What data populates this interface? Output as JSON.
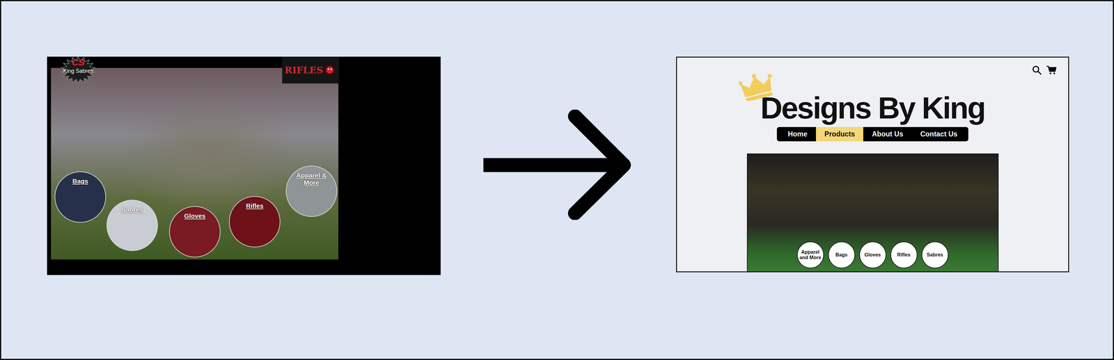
{
  "before": {
    "logo": {
      "mark": "CS",
      "name": "King Sabres"
    },
    "badge": "RIFLES",
    "categories": [
      {
        "label": "Bags",
        "color": "#26304a"
      },
      {
        "label": "Sabres",
        "color": "#c9ccd3"
      },
      {
        "label": "Gloves",
        "color": "#7a1a22"
      },
      {
        "label": "Rifles",
        "color": "#6e1119"
      },
      {
        "label": "Apparel & More",
        "color": "#8f9497"
      }
    ]
  },
  "after": {
    "title": "Designs By King",
    "nav": [
      {
        "label": "Home",
        "selected": false
      },
      {
        "label": "Products",
        "selected": true
      },
      {
        "label": "About Us",
        "selected": false
      },
      {
        "label": "Contact Us",
        "selected": false
      }
    ],
    "categories": [
      "Apparel and More",
      "Bags",
      "Gloves",
      "Rifles",
      "Sabres"
    ]
  }
}
